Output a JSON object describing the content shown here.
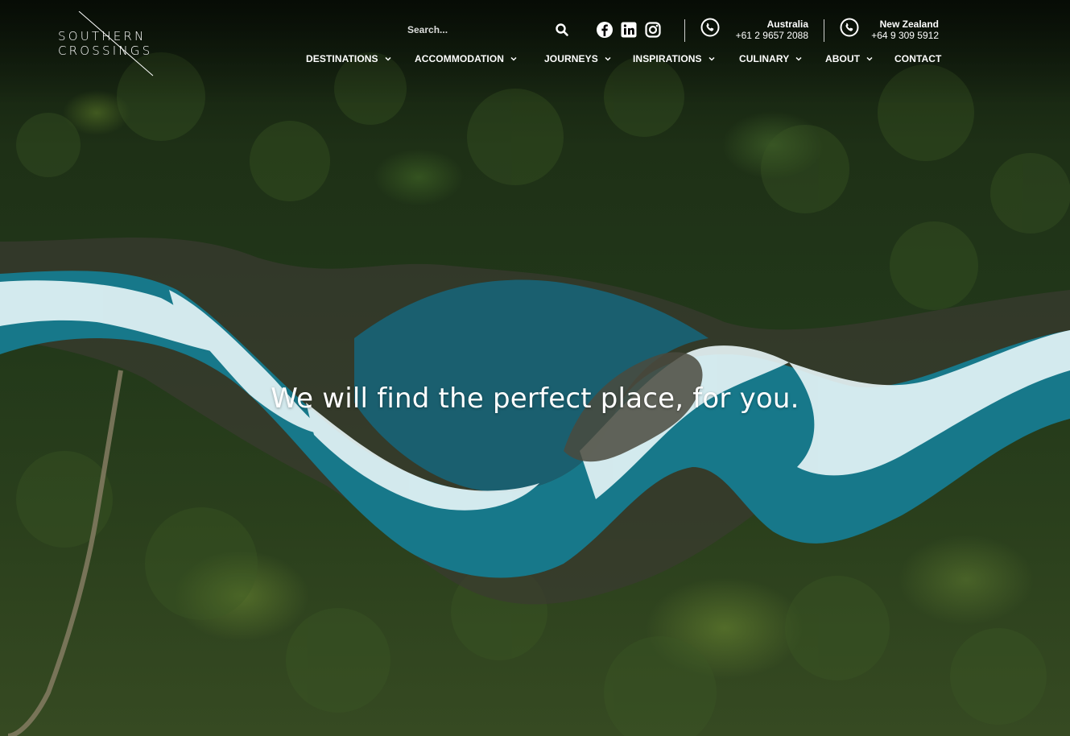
{
  "brand": {
    "line1": "SOUTHERN",
    "line2": "CROSSINGS"
  },
  "search": {
    "placeholder": "Search..."
  },
  "social": {
    "icons": [
      "facebook-icon",
      "linkedin-icon",
      "instagram-icon"
    ]
  },
  "contacts": [
    {
      "country": "Australia",
      "phone": "+61 2 9657 2088"
    },
    {
      "country": "New Zealand",
      "phone": "+64 9 309 5912"
    }
  ],
  "nav": [
    {
      "label": "DESTINATIONS",
      "dropdown": true
    },
    {
      "label": "ACCOMMODATION",
      "dropdown": true
    },
    {
      "label": "JOURNEYS",
      "dropdown": true
    },
    {
      "label": "INSPIRATIONS",
      "dropdown": true
    },
    {
      "label": "CULINARY",
      "dropdown": true
    },
    {
      "label": "ABOUT",
      "dropdown": true
    },
    {
      "label": "CONTACT",
      "dropdown": false
    }
  ],
  "hero": {
    "headline": "We will find the perfect place, for you."
  },
  "colors": {
    "river": "#1b8fa0",
    "foam": "#e8f6f8",
    "forest": "#22381a"
  }
}
